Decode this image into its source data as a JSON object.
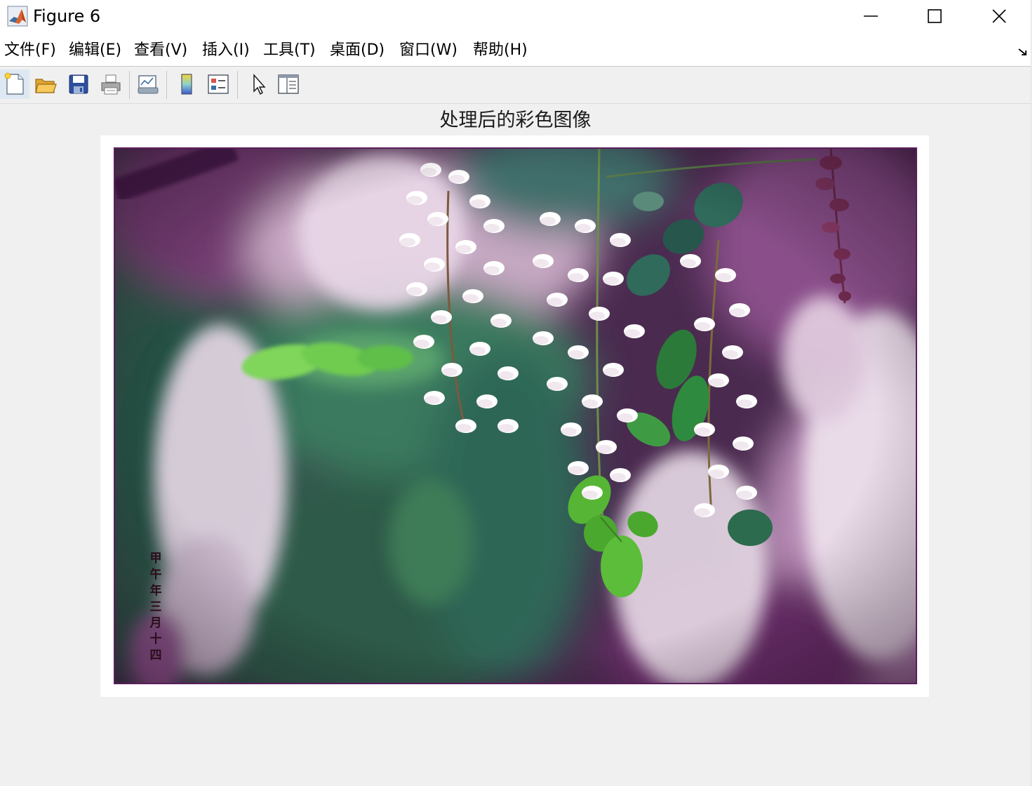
{
  "window": {
    "title": "Figure 6"
  },
  "menubar": {
    "items": [
      {
        "label": "文件(F)"
      },
      {
        "label": "编辑(E)"
      },
      {
        "label": "查看(V)"
      },
      {
        "label": "插入(I)"
      },
      {
        "label": "工具(T)"
      },
      {
        "label": "桌面(D)"
      },
      {
        "label": "窗口(W)"
      },
      {
        "label": "帮助(H)"
      }
    ]
  },
  "toolbar": {
    "buttons": [
      {
        "icon": "new-figure-icon"
      },
      {
        "icon": "open-file-icon"
      },
      {
        "icon": "save-icon"
      },
      {
        "icon": "print-icon"
      },
      {
        "icon": "link-plot-icon"
      },
      {
        "icon": "insert-colorbar-icon"
      },
      {
        "icon": "insert-legend-icon"
      },
      {
        "icon": "edit-plot-pointer-icon"
      },
      {
        "icon": "property-inspector-icon"
      }
    ]
  },
  "axes": {
    "title": "处理后的彩色图像",
    "signature": "甲午年三月十四"
  },
  "colors": {
    "titlebar_bg": "#ffffff",
    "figure_bg": "#f0f0f0",
    "axes_bg": "#ffffff",
    "frame_border": "#5a1f5c"
  }
}
